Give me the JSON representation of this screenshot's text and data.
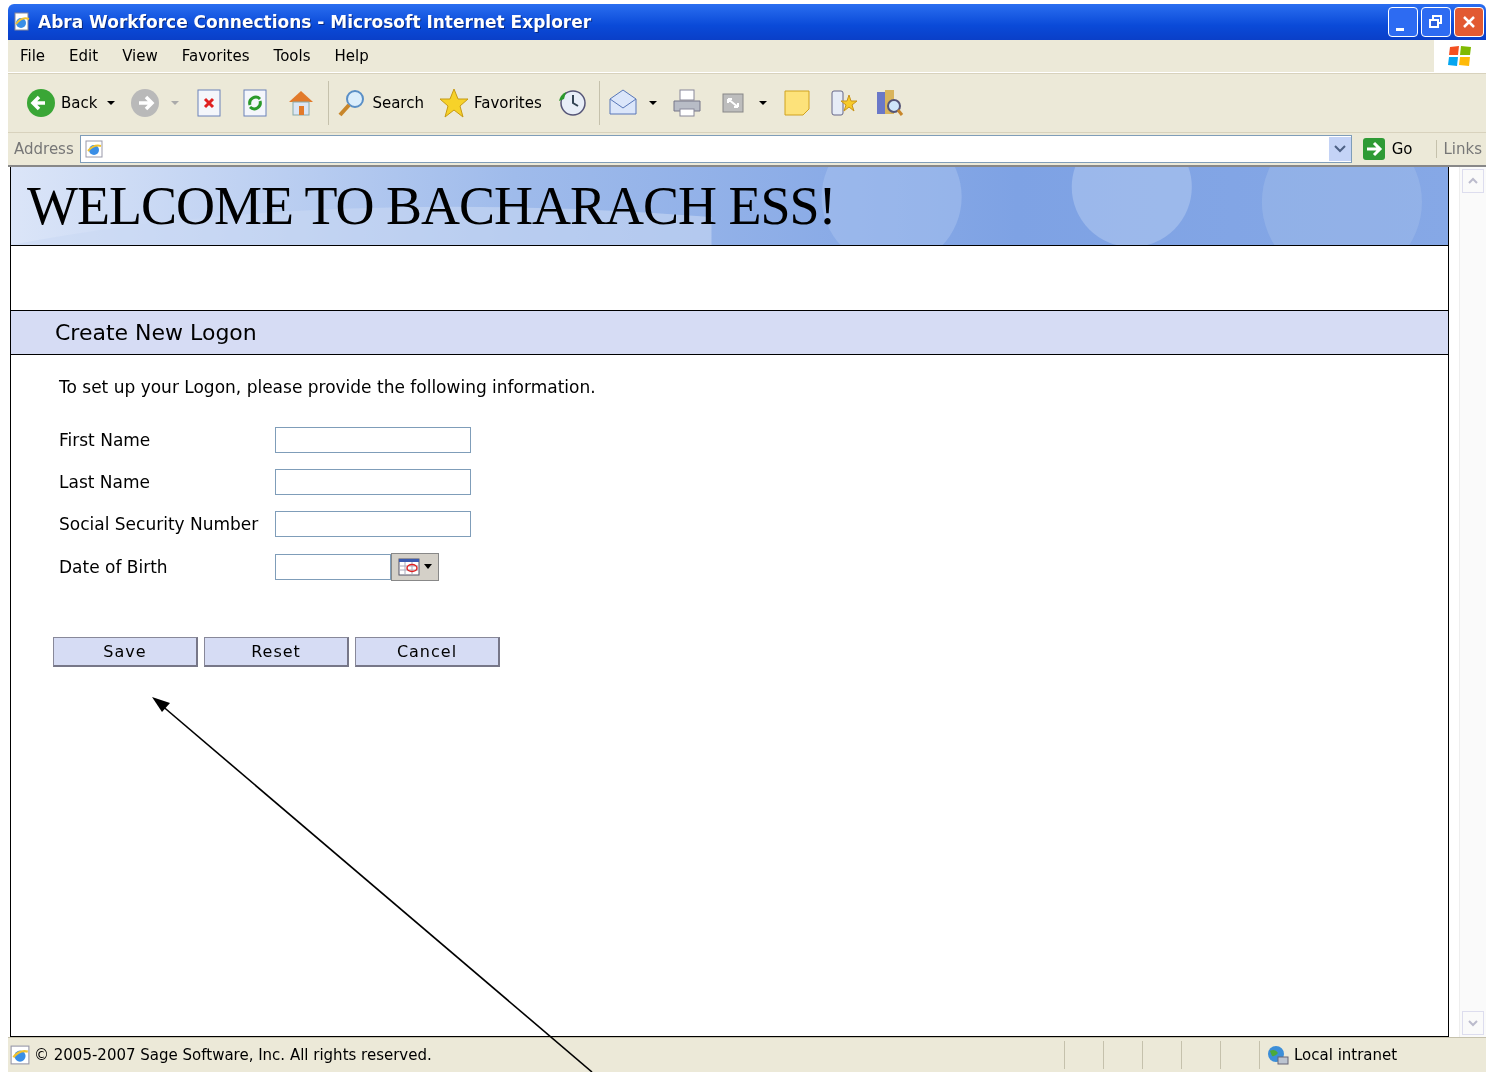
{
  "window": {
    "title": "Abra Workforce Connections - Microsoft Internet Explorer"
  },
  "menu": [
    "File",
    "Edit",
    "View",
    "Favorites",
    "Tools",
    "Help"
  ],
  "toolbar": [
    {
      "kind": "back",
      "label": "Back",
      "dropdown": true
    },
    {
      "kind": "forward",
      "dropdown": true
    },
    {
      "kind": "stop"
    },
    {
      "kind": "refresh"
    },
    {
      "kind": "home"
    },
    {
      "kind": "search",
      "label": "Search"
    },
    {
      "kind": "favorites",
      "label": "Favorites"
    },
    {
      "kind": "history"
    },
    {
      "kind": "mail",
      "dropdown": true
    },
    {
      "kind": "print"
    },
    {
      "kind": "resize",
      "dropdown": true
    },
    {
      "kind": "note"
    },
    {
      "kind": "messenger"
    },
    {
      "kind": "research"
    }
  ],
  "address": {
    "label": "Address",
    "go": "Go",
    "links": "Links"
  },
  "page": {
    "banner": "WELCOME TO BACHARACH ESS!",
    "section_title": "Create New Logon",
    "intro": "To set up your Logon, please provide the following information.",
    "fields": [
      {
        "label": "First Name",
        "kind": "text"
      },
      {
        "label": "Last Name",
        "kind": "text"
      },
      {
        "label": "Social Security Number",
        "kind": "text"
      },
      {
        "label": "Date of Birth",
        "kind": "date"
      }
    ],
    "buttons": [
      "Save",
      "Reset",
      "Cancel"
    ]
  },
  "status_bar": {
    "text": "© 2005-2007 Sage Software, Inc. All rights reserved.",
    "zone": "Local intranet"
  }
}
